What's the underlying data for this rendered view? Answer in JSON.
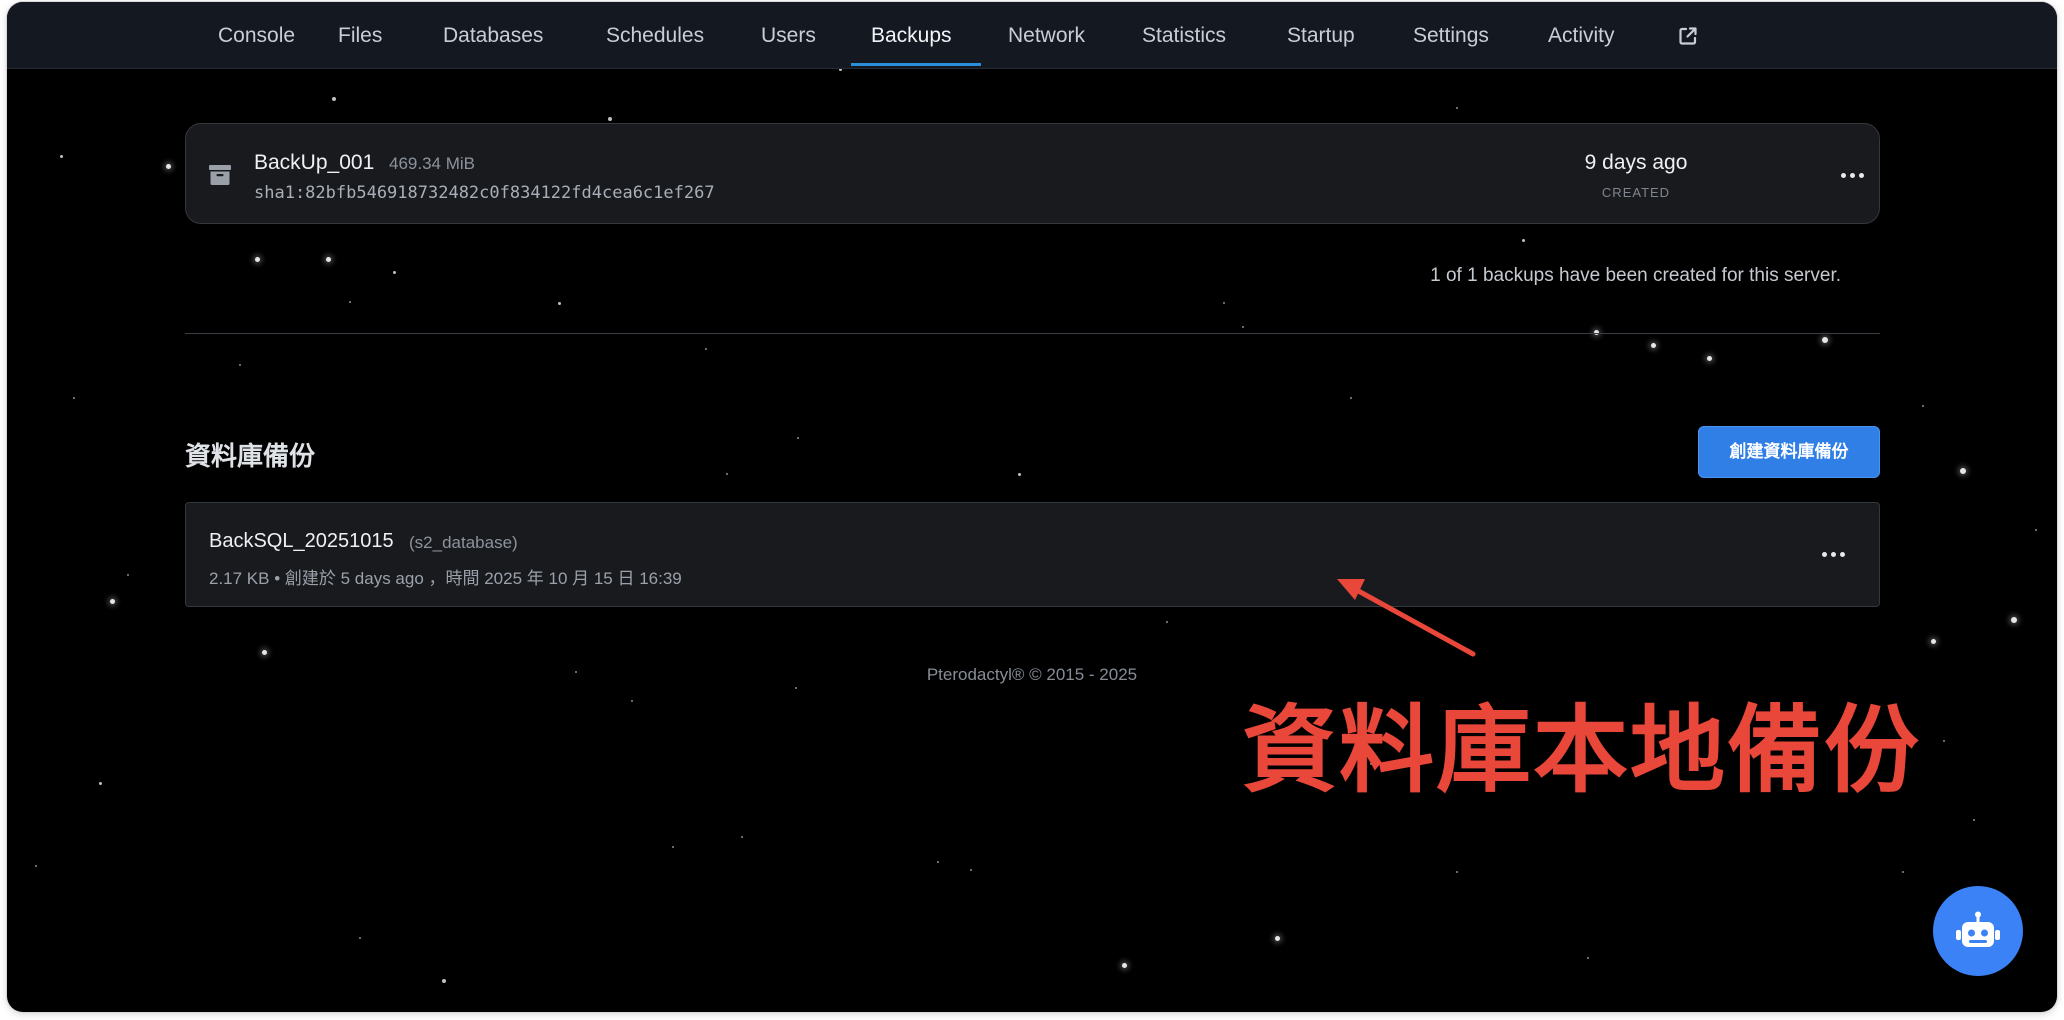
{
  "nav": {
    "items": [
      {
        "label": "Console"
      },
      {
        "label": "Files"
      },
      {
        "label": "Databases"
      },
      {
        "label": "Schedules"
      },
      {
        "label": "Users"
      },
      {
        "label": "Backups"
      },
      {
        "label": "Network"
      },
      {
        "label": "Statistics"
      },
      {
        "label": "Startup"
      },
      {
        "label": "Settings"
      },
      {
        "label": "Activity"
      }
    ],
    "active": "Backups",
    "external_icon": "external-link-icon"
  },
  "backups": {
    "items": [
      {
        "name": "BackUp_001",
        "size": "469.34 MiB",
        "hash": "sha1:82bfb546918732482c0f834122fd4cea6c1ef267",
        "date": "9 days ago",
        "date_label": "CREATED",
        "icon": "archive-icon"
      }
    ],
    "summary": "1 of 1 backups have been created for this server."
  },
  "db_backups": {
    "title": "資料庫備份",
    "create_label": "創建資料庫備份",
    "items": [
      {
        "name": "BackSQL_20251015",
        "database": "(s2_database)",
        "meta": "2.17 KB • 創建於 5 days ago ，時間 2025 年 10 月 15 日 16:39"
      }
    ]
  },
  "footer": "Pterodactyl® © 2015 - 2025",
  "annotation": {
    "text": "資料庫本地備份",
    "color": "#e8473a"
  },
  "colors": {
    "accent": "#2f7fe6",
    "nav_underline": "#2a8fd8",
    "background": "#000000"
  }
}
